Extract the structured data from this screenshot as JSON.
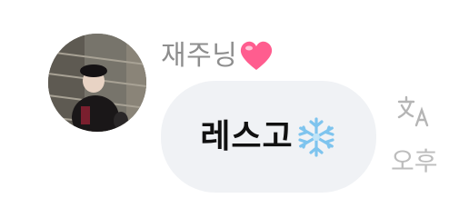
{
  "message": {
    "sender_name": "재주닝",
    "sender_emoji": "heart-icon",
    "text": "레스고",
    "text_emoji": "snowflake-icon",
    "timestamp_partial": "오후"
  },
  "icons": {
    "translate": "translate-icon"
  },
  "colors": {
    "sender_name": "#8e8e8e",
    "bubble_bg": "#f0f2f5",
    "message_text": "#111111",
    "timestamp": "#bdbdbd",
    "heart": "#ff5d8f",
    "snowflake": "#7ec4ee"
  }
}
